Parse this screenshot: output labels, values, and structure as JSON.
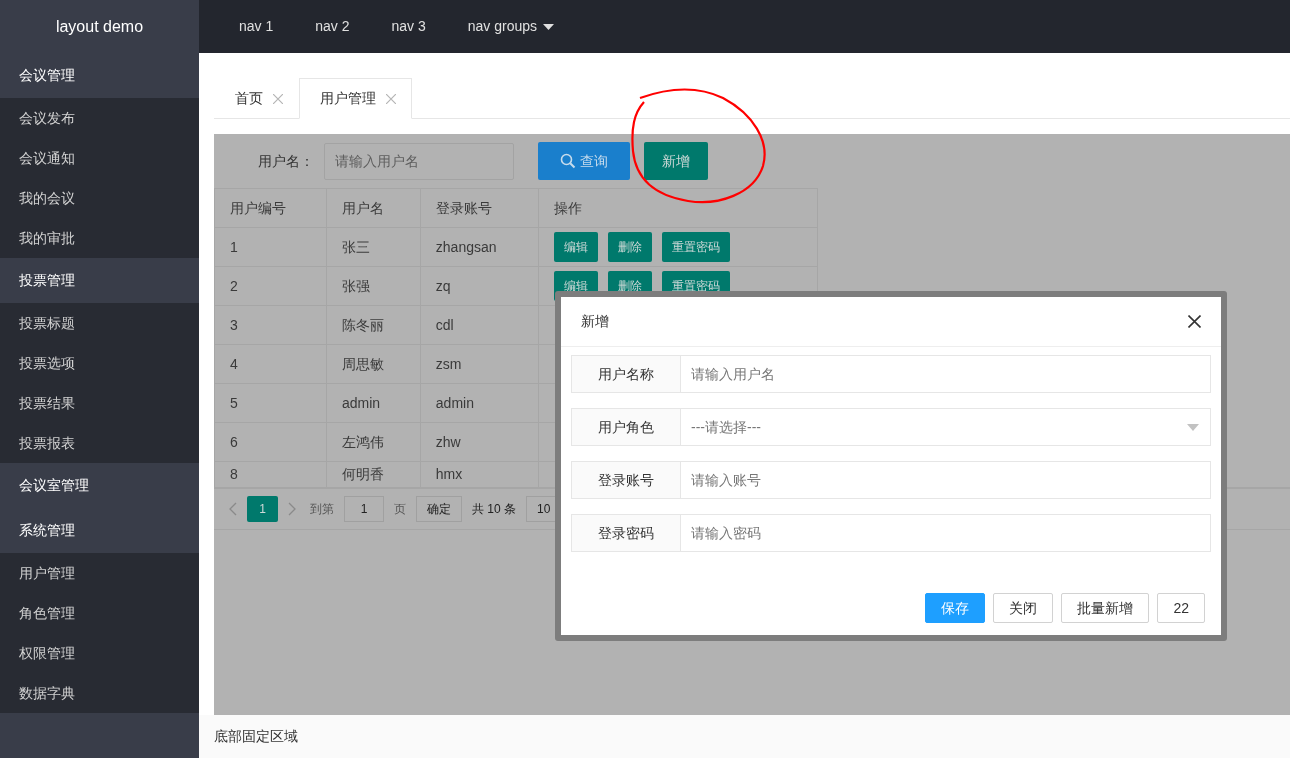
{
  "sidebar": {
    "logo": "layout demo",
    "groups": [
      {
        "label": "会议管理",
        "items": [
          "会议发布",
          "会议通知",
          "我的会议",
          "我的审批"
        ]
      },
      {
        "label": "投票管理",
        "items": [
          "投票标题",
          "投票选项",
          "投票结果",
          "投票报表"
        ]
      },
      {
        "label": "会议室管理"
      },
      {
        "label": "系统管理",
        "items": [
          "用户管理",
          "角色管理",
          "权限管理",
          "数据字典"
        ]
      }
    ]
  },
  "top_nav": [
    {
      "label": "nav 1",
      "kind": "link"
    },
    {
      "label": "nav 2",
      "kind": "link"
    },
    {
      "label": "nav 3",
      "kind": "link"
    },
    {
      "label": "nav groups",
      "kind": "dropdown"
    }
  ],
  "tabs": [
    {
      "label": "首页",
      "selected": false
    },
    {
      "label": "用户管理",
      "selected": true
    }
  ],
  "search": {
    "label": "用户名：",
    "placeholder": "请输入用户名"
  },
  "toolbar_buttons": [
    {
      "label": "查询",
      "kind": "search"
    },
    {
      "label": "新增",
      "kind": "add"
    }
  ],
  "table": {
    "columns": [
      "用户编号",
      "用户名",
      "登录账号",
      "操作"
    ],
    "rows": [
      {
        "cells": [
          "1",
          "张三",
          "zhangsan"
        ],
        "actions": [
          "编辑",
          "删除",
          "重置密码"
        ]
      },
      {
        "cells": [
          "2",
          "张强",
          "zq"
        ],
        "actions": [
          "编辑",
          "删除",
          "重置密码"
        ]
      },
      {
        "cells": [
          "3",
          "陈冬丽",
          "cdl"
        ]
      },
      {
        "cells": [
          "4",
          "周思敏",
          "zsm"
        ]
      },
      {
        "cells": [
          "5",
          "admin",
          "admin"
        ]
      },
      {
        "cells": [
          "6",
          "左鸿伟",
          "zhw"
        ]
      },
      {
        "cells": [
          "8",
          "何明香",
          "hmx"
        ]
      }
    ]
  },
  "pagination": {
    "pages": [
      {
        "label": "1",
        "selected": true
      }
    ],
    "goto_label": "到第",
    "goto_value": "1",
    "page_unit": "页",
    "confirm": "确定",
    "total": "共 10 条",
    "page_size": "10"
  },
  "dialog": {
    "title": "新增",
    "fields": [
      {
        "label": "用户名称",
        "placeholder": "请输入用户名",
        "kind": "text"
      },
      {
        "label": "用户角色",
        "placeholder": "---请选择---",
        "kind": "select"
      },
      {
        "label": "登录账号",
        "placeholder": "请输入账号",
        "kind": "text"
      },
      {
        "label": "登录密码",
        "placeholder": "请输入密码",
        "kind": "password"
      }
    ],
    "buttons": [
      {
        "label": "保存",
        "kind": "primary"
      },
      {
        "label": "关闭",
        "kind": "default"
      },
      {
        "label": "批量新增",
        "kind": "default"
      },
      {
        "label": "22",
        "kind": "default"
      }
    ]
  },
  "annotation": {
    "kind": "circle"
  },
  "footer": "底部固定区域"
}
